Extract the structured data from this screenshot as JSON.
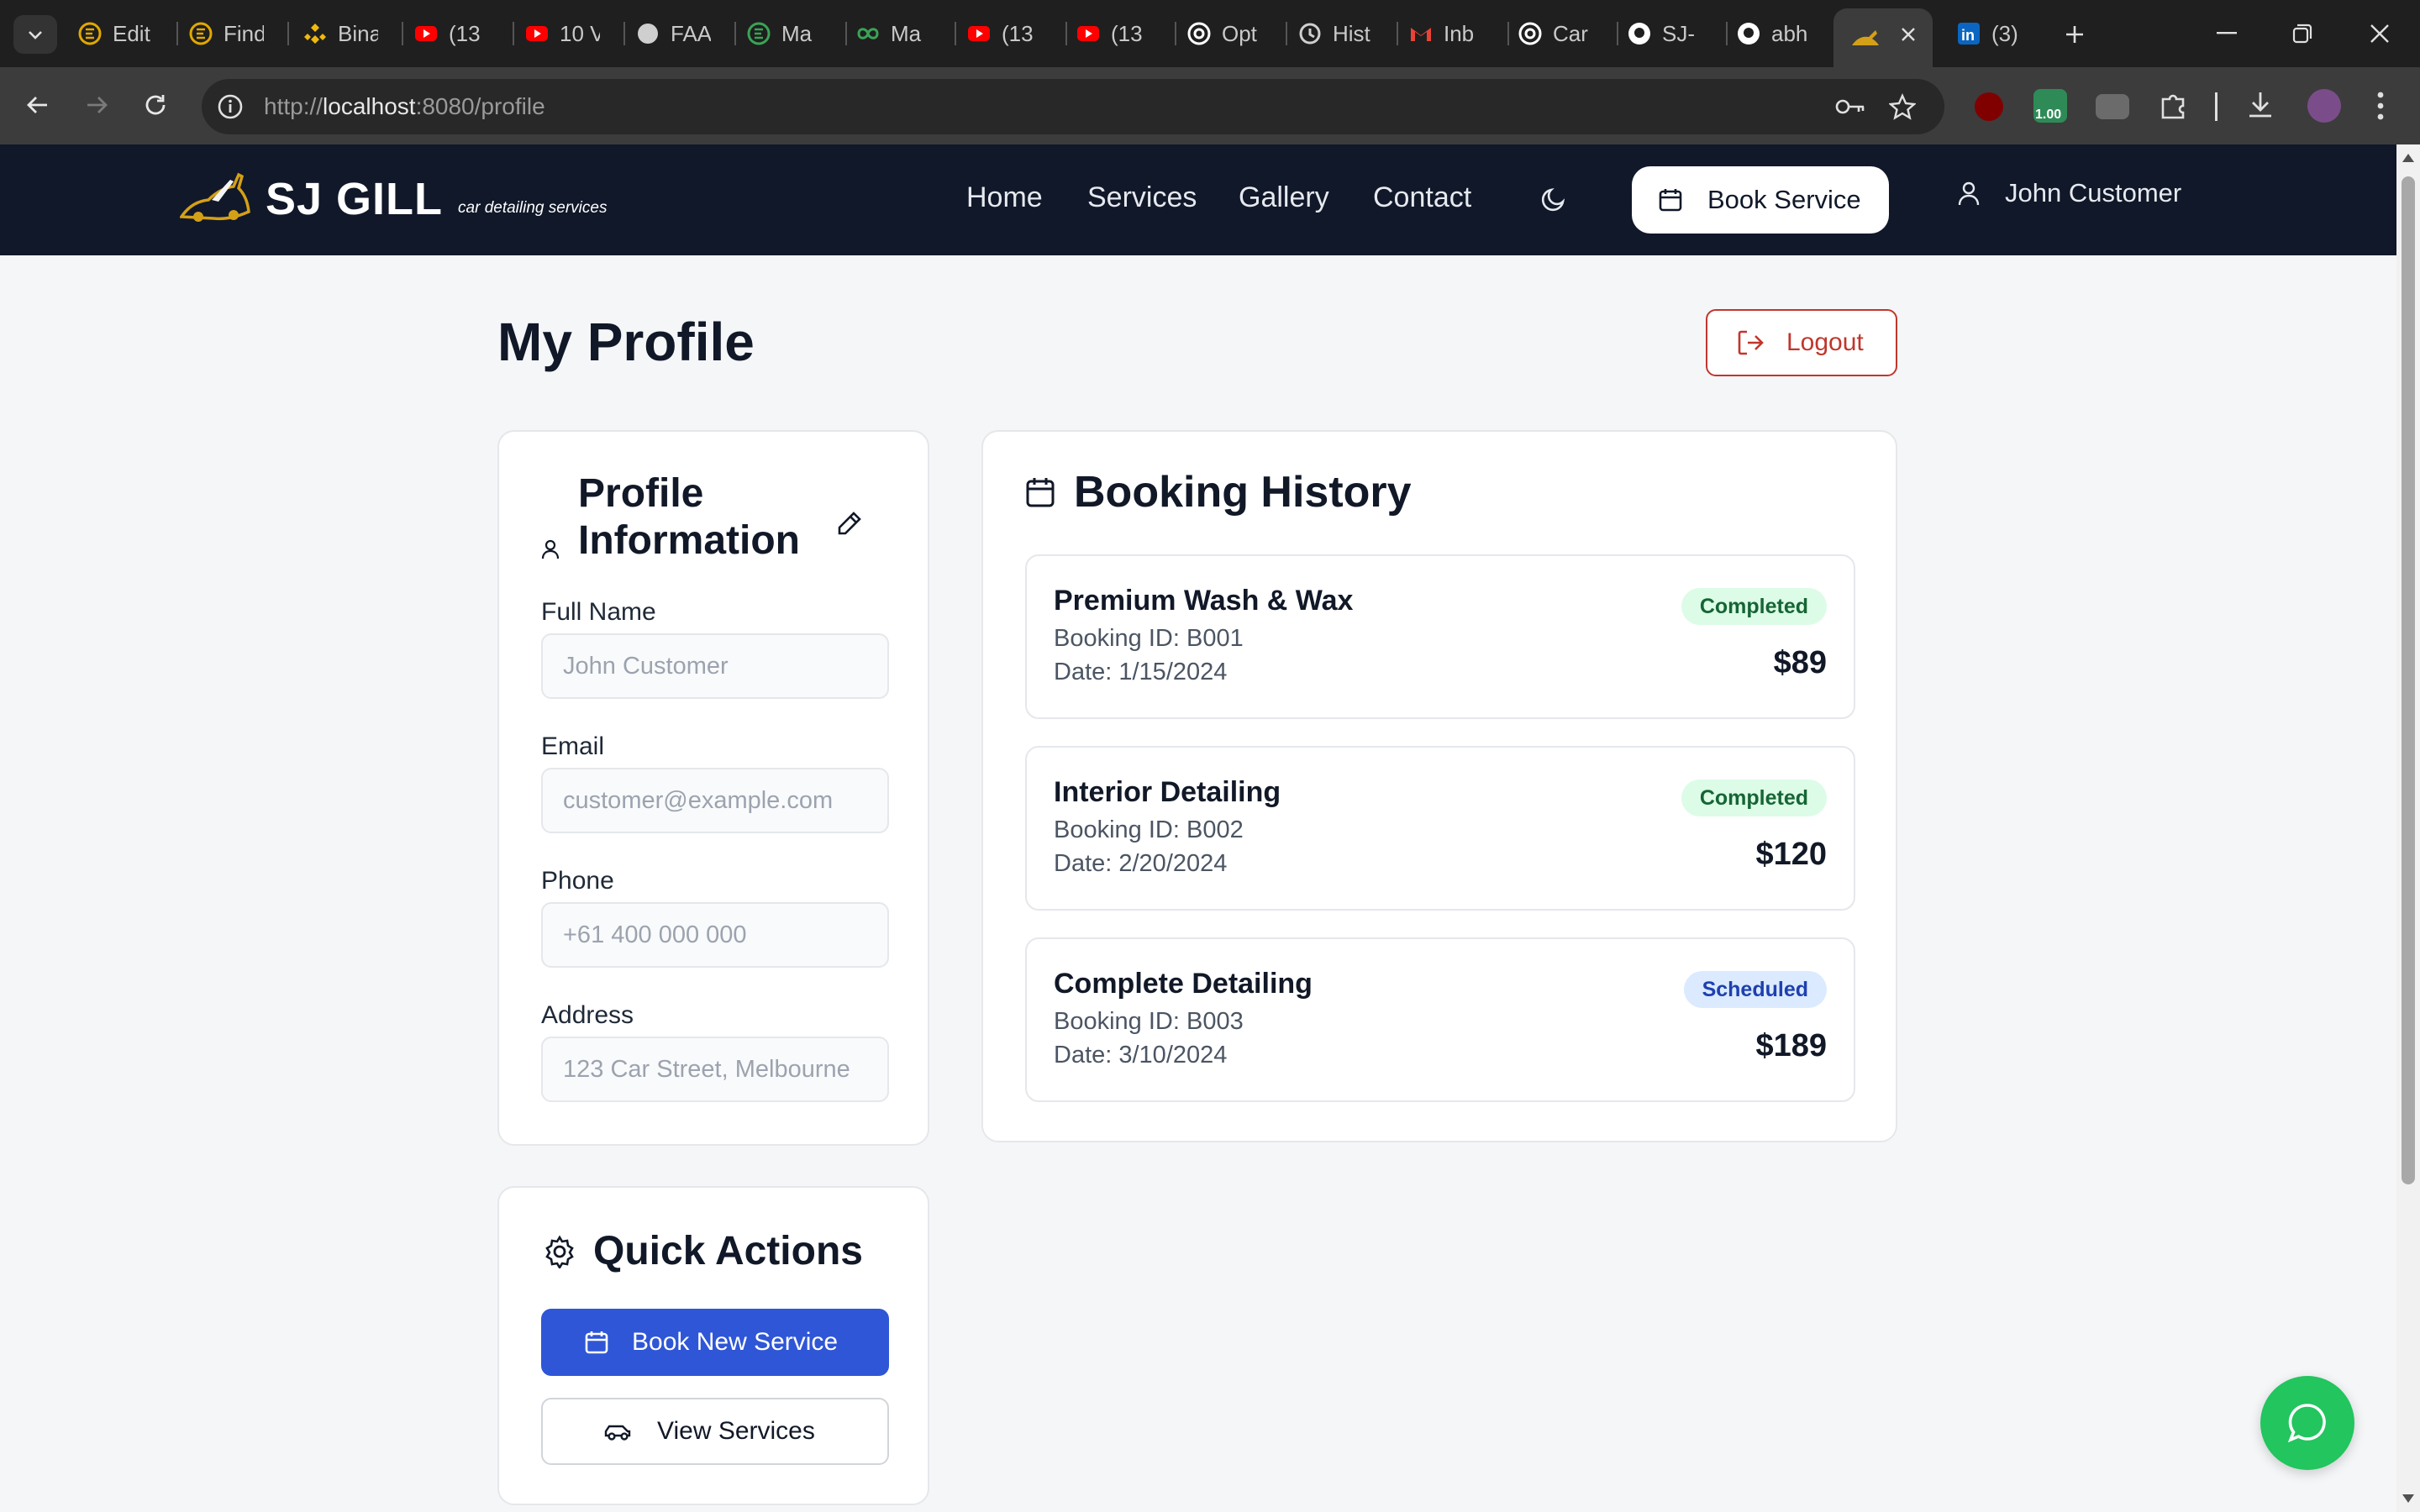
{
  "browser": {
    "tabs": [
      {
        "label": "Edit",
        "icon": "circle-logo-icon",
        "color": "#e0a800"
      },
      {
        "label": "Find",
        "icon": "circle-logo-icon",
        "color": "#e0a800"
      },
      {
        "label": "Bina",
        "icon": "binance-icon",
        "color": "#f0b90b"
      },
      {
        "label": "(13",
        "icon": "youtube-icon",
        "color": "#ff0000"
      },
      {
        "label": "10 V",
        "icon": "youtube-icon",
        "color": "#ff0000"
      },
      {
        "label": "FAA",
        "icon": "globe-icon",
        "color": "#cfcfcf"
      },
      {
        "label": "Ma",
        "icon": "circle-logo-icon",
        "color": "#3aa356"
      },
      {
        "label": "Ma",
        "icon": "infinity-icon",
        "color": "#3aa356"
      },
      {
        "label": "(13",
        "icon": "youtube-icon",
        "color": "#ff0000"
      },
      {
        "label": "(13",
        "icon": "youtube-icon",
        "color": "#ff0000"
      },
      {
        "label": "Opt",
        "icon": "openai-icon",
        "color": "#ffffff"
      },
      {
        "label": "Hist",
        "icon": "history-icon",
        "color": "#cfcfcf"
      },
      {
        "label": "Inb",
        "icon": "gmail-icon",
        "color": "#ea4335"
      },
      {
        "label": "Car",
        "icon": "openai-icon",
        "color": "#ffffff"
      },
      {
        "label": "SJ-",
        "icon": "github-icon",
        "color": "#ffffff"
      },
      {
        "label": "abh",
        "icon": "github-icon",
        "color": "#ffffff"
      },
      {
        "label": "(3)",
        "icon": "linkedin-icon",
        "color": "#0a66c2"
      }
    ],
    "url_host": "localhost",
    "url_prefix": "http://",
    "url_rest": ":8080/profile",
    "extension_badge": "1.00"
  },
  "header": {
    "brand_name": "SJ GILL",
    "brand_tagline": "car detailing services",
    "nav": [
      "Home",
      "Services",
      "Gallery",
      "Contact"
    ],
    "book_button": "Book Service",
    "user_name": "John Customer"
  },
  "page": {
    "title": "My Profile",
    "logout_label": "Logout"
  },
  "profile": {
    "title": "Profile Information",
    "fields": [
      {
        "label": "Full Name",
        "placeholder": "John Customer"
      },
      {
        "label": "Email",
        "placeholder": "customer@example.com"
      },
      {
        "label": "Phone",
        "placeholder": "+61 400 000 000"
      },
      {
        "label": "Address",
        "placeholder": "123 Car Street, Melbourne"
      }
    ]
  },
  "quick_actions": {
    "title": "Quick Actions",
    "primary": "Book New Service",
    "secondary": "View Services"
  },
  "bookings": {
    "title": "Booking History",
    "items": [
      {
        "name": "Premium Wash & Wax",
        "id": "Booking ID: B001",
        "date": "Date: 1/15/2024",
        "status": "Completed",
        "price": "$89"
      },
      {
        "name": "Interior Detailing",
        "id": "Booking ID: B002",
        "date": "Date: 2/20/2024",
        "status": "Completed",
        "price": "$120"
      },
      {
        "name": "Complete Detailing",
        "id": "Booking ID: B003",
        "date": "Date: 3/10/2024",
        "status": "Scheduled",
        "price": "$189"
      }
    ]
  },
  "colors": {
    "header_bg": "#101829",
    "primary_blue": "#2f56d6",
    "logout_red": "#c1362d",
    "chat_green": "#22c55e",
    "completed_bg": "#dcfce7",
    "scheduled_bg": "#dbeafe"
  }
}
